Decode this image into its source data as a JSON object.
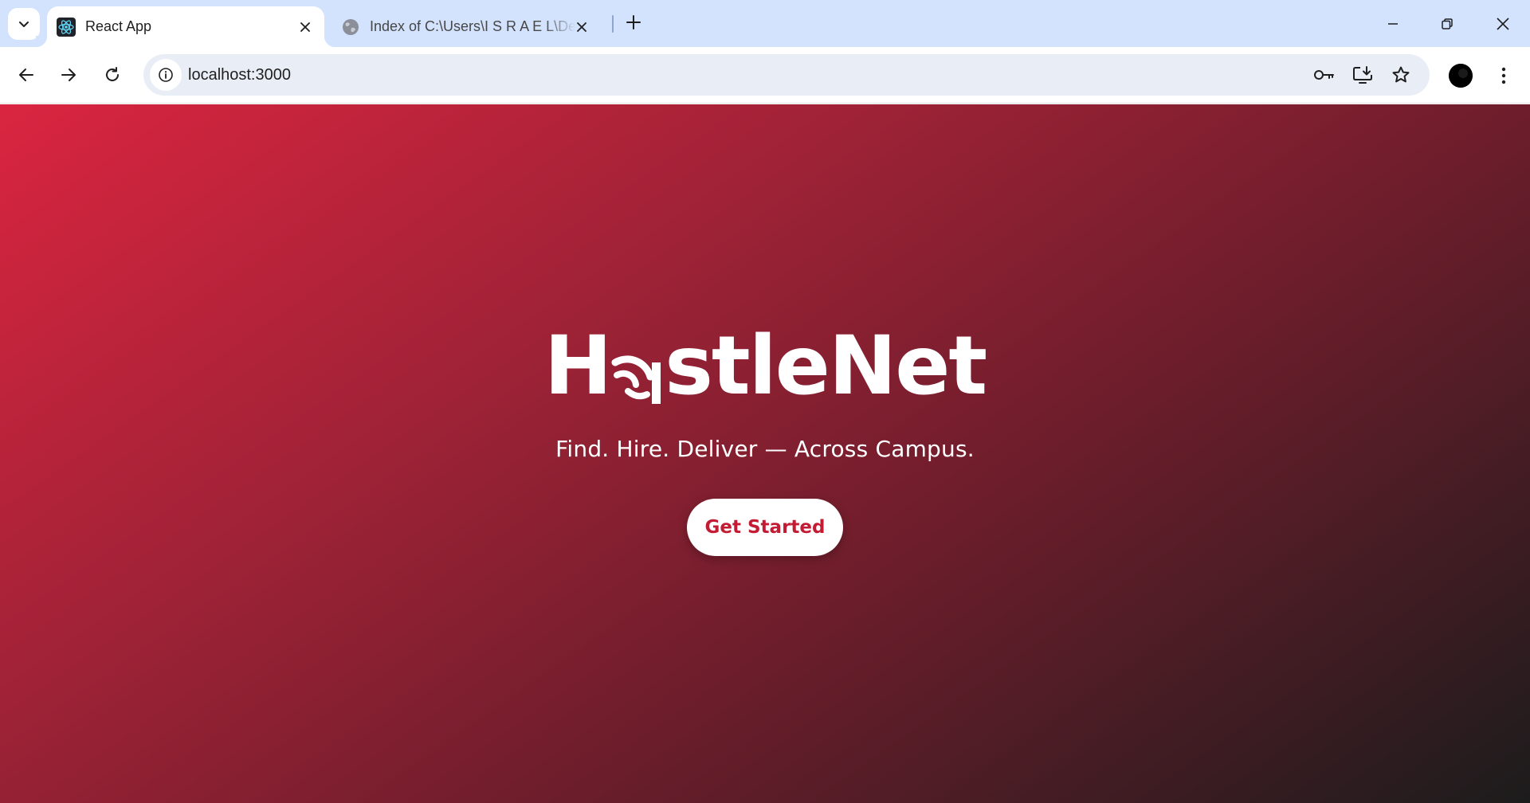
{
  "tabs": [
    {
      "title": "React App",
      "icon": "react-logo-icon",
      "active": true
    },
    {
      "title": "Index of C:\\Users\\I S R A E L\\Desktop",
      "icon": "globe-icon",
      "active": false
    }
  ],
  "address_bar": {
    "url": "localhost:3000"
  },
  "hero": {
    "logo_prefix": "H",
    "logo_suffix": "stleNet",
    "tagline": "Find. Hire. Deliver — Across Campus.",
    "cta_label": "Get Started"
  },
  "colors": {
    "tab_strip": "#d3e3fd",
    "gradient_start": "#da2540",
    "gradient_end": "#1c1c1c",
    "cta_text": "#c41b35"
  }
}
